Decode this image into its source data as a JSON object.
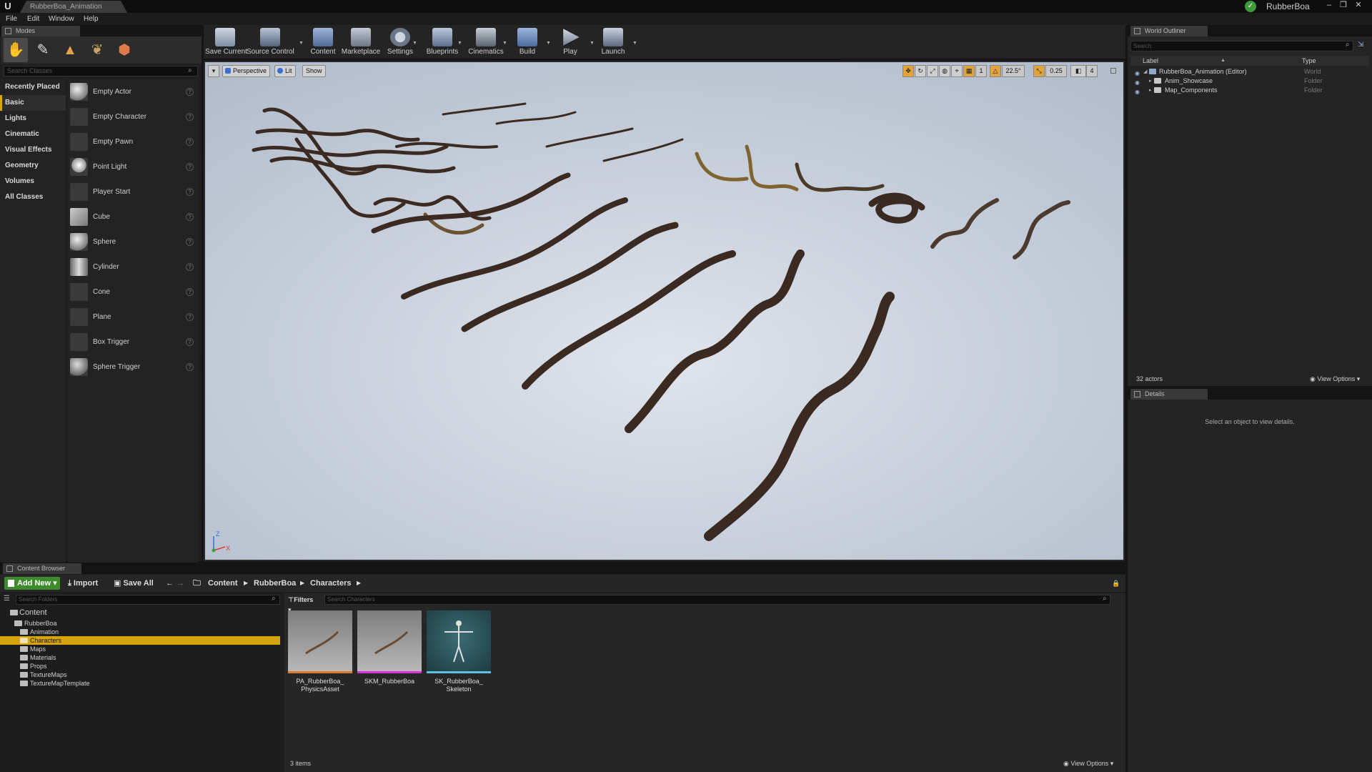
{
  "title_bar": {
    "document_tab": "RubberBoa_Animation",
    "project_name": "RubberBoa",
    "logo_glyph": "U",
    "window_buttons": [
      "‒",
      "❐",
      "✕"
    ]
  },
  "menu": [
    "File",
    "Edit",
    "Window",
    "Help"
  ],
  "modes": {
    "tab_label": "Modes",
    "search_placeholder": "Search Classes",
    "categories": [
      "Recently Placed",
      "Basic",
      "Lights",
      "Cinematic",
      "Visual Effects",
      "Geometry",
      "Volumes",
      "All Classes"
    ],
    "selected_category": "Basic",
    "items": [
      "Empty Actor",
      "Empty Character",
      "Empty Pawn",
      "Point Light",
      "Player Start",
      "Cube",
      "Sphere",
      "Cylinder",
      "Cone",
      "Plane",
      "Box Trigger",
      "Sphere Trigger"
    ],
    "help_glyph": "?"
  },
  "toolbar": {
    "buttons": [
      "Save Current",
      "Source Control",
      "Content",
      "Marketplace",
      "Settings",
      "Blueprints",
      "Cinematics",
      "Build",
      "Play",
      "Launch"
    ]
  },
  "viewport": {
    "perspective_label": "Perspective",
    "lit_label": "Lit",
    "show_label": "Show",
    "grid_snap_value": "1",
    "rotation_snap_value": "22.5°",
    "scale_snap_value": "0.25",
    "camera_speed_value": "4",
    "axis_labels": {
      "z": "Z",
      "x": "X"
    }
  },
  "world_outliner": {
    "tab_label": "World Outliner",
    "search_placeholder": "Search",
    "columns": {
      "label": "Label",
      "type": "Type"
    },
    "rows": [
      {
        "label": "RubberBoa_Animation (Editor)",
        "type": "World"
      },
      {
        "label": "Anim_Showcase",
        "type": "Folder"
      },
      {
        "label": "Map_Components",
        "type": "Folder"
      }
    ],
    "actor_count": "32 actors",
    "view_options": "View Options"
  },
  "details": {
    "tab_label": "Details",
    "empty_message": "Select an object to view details."
  },
  "content_browser": {
    "tab_label": "Content Browser",
    "add_new": "Add New",
    "import": "Import",
    "save_all": "Save All",
    "breadcrumb": [
      "Content",
      "RubberBoa",
      "Characters"
    ],
    "folder_search_placeholder": "Search Folders",
    "filters_label": "Filters",
    "asset_search_placeholder": "Search Characters",
    "folders": [
      {
        "name": "Content",
        "depth": 0
      },
      {
        "name": "RubberBoa",
        "depth": 1
      },
      {
        "name": "Animation",
        "depth": 2
      },
      {
        "name": "Characters",
        "depth": 2,
        "selected": true
      },
      {
        "name": "Maps",
        "depth": 2
      },
      {
        "name": "Materials",
        "depth": 2
      },
      {
        "name": "Props",
        "depth": 2
      },
      {
        "name": "TextureMaps",
        "depth": 2
      },
      {
        "name": "TextureMapTemplate",
        "depth": 2
      }
    ],
    "assets": [
      {
        "name": "PA_RubberBoa_ PhysicsAsset",
        "accent": "#d77b2a"
      },
      {
        "name": "SKM_RubberBoa",
        "accent": "#d432d4"
      },
      {
        "name": "SK_RubberBoa_ Skeleton",
        "accent": "#5bc1e0"
      }
    ],
    "item_count": "3 items",
    "view_options": "View Options"
  },
  "colors": {
    "accent": "#d8a40d",
    "add_new": "#3d8b2c",
    "viewport_bg": "#bfc7d5"
  }
}
